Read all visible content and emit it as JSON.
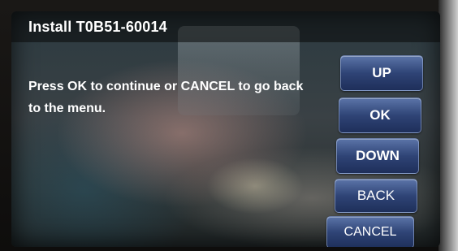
{
  "header": {
    "title": "Install T0B51-60014"
  },
  "main": {
    "message": "Press OK to continue or CANCEL to go back to the menu."
  },
  "buttons": {
    "up": "UP",
    "ok": "OK",
    "down": "DOWN",
    "back": "BACK",
    "cancel": "CANCEL"
  },
  "colors": {
    "button_top": "#5b74a8",
    "button_bottom": "#1e2f5a",
    "text": "#ffffff"
  }
}
